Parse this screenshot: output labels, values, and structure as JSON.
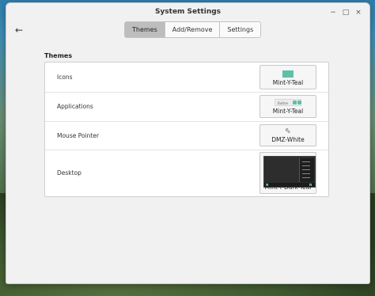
{
  "window": {
    "title": "System Settings",
    "controls": {
      "minimize": "−",
      "maximize": "□",
      "close": "×"
    }
  },
  "nav": {
    "back_icon": "arrow-left-icon",
    "tabs": [
      {
        "label": "Themes",
        "active": true
      },
      {
        "label": "Add/Remove",
        "active": false
      },
      {
        "label": "Settings",
        "active": false
      }
    ]
  },
  "themes": {
    "section_title": "Themes",
    "rows": [
      {
        "label": "Icons",
        "value": "Mint-Y-Teal",
        "preview": "icon-swatch"
      },
      {
        "label": "Applications",
        "value": "Mint-Y-Teal",
        "preview": "app-preview",
        "preview_text": "Button"
      },
      {
        "label": "Mouse Pointer",
        "value": "DMZ-White",
        "preview": "cursor-icon"
      },
      {
        "label": "Desktop",
        "value": "Mint-Y-Dark-Teal",
        "preview": "desktop-preview"
      }
    ]
  },
  "colors": {
    "accent": "#5fbfa7",
    "active_tab": "#bdbdbd",
    "window_bg": "#f1f1f1"
  }
}
